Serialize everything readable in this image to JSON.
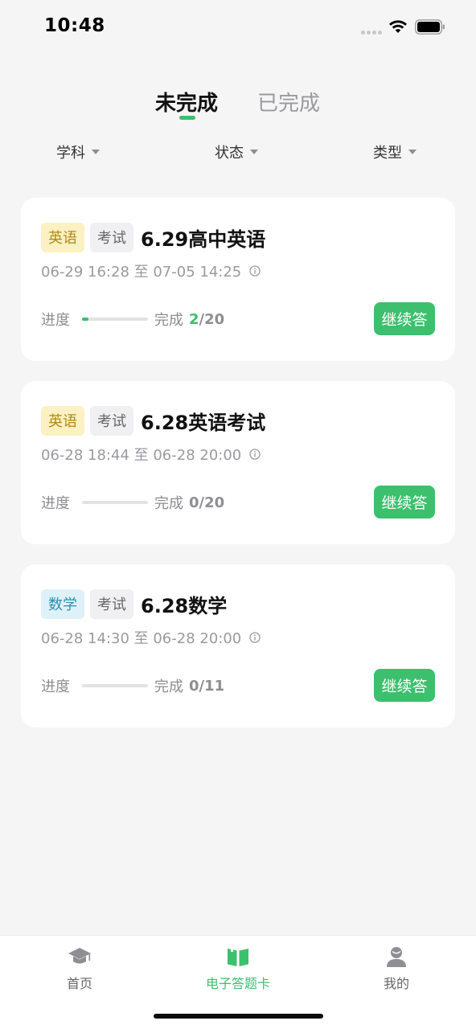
{
  "status_bar": {
    "time": "10:48"
  },
  "tabs": {
    "active": "未完成",
    "inactive": "已完成"
  },
  "filters": {
    "subject": "学科",
    "status": "状态",
    "type": "类型"
  },
  "cards": [
    {
      "subject": "英语",
      "kind": "考试",
      "title": "6.29高中英语",
      "time": "06-29 16:28 至 07-05 14:25",
      "progress_label": "进度",
      "done_label": "完成",
      "done_current": "2",
      "done_total": "/20",
      "progress": 0.1,
      "button": "继续答"
    },
    {
      "subject": "英语",
      "kind": "考试",
      "title": "6.28英语考试",
      "time": "06-28 18:44 至 06-28 20:00",
      "progress_label": "进度",
      "done_label": "完成",
      "done_current": "0",
      "done_total": "/20",
      "progress": 0,
      "button": "继续答"
    },
    {
      "subject": "数学",
      "kind": "考试",
      "title": "6.28数学",
      "time": "06-28 14:30 至 06-28 20:00",
      "progress_label": "进度",
      "done_label": "完成",
      "done_current": "0",
      "done_total": "/11",
      "progress": 0,
      "button": "继续答"
    }
  ],
  "nav": {
    "home": "首页",
    "answer_card": "电子答题卡",
    "me": "我的"
  },
  "colors": {
    "accent": "#3cc06d",
    "english_tag": "#fbf1c3",
    "math_tag": "#dff1f8"
  },
  "icons": {
    "home": "graduation-cap-icon",
    "answer_card": "open-book-icon",
    "me": "person-icon"
  }
}
